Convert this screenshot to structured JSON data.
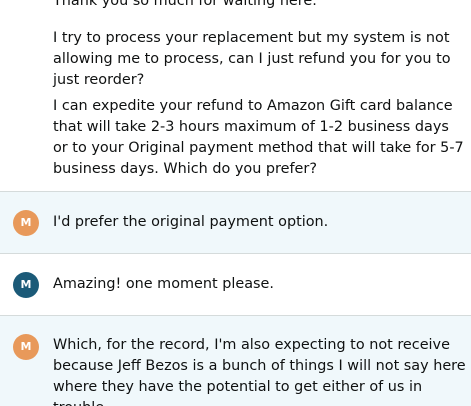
{
  "conversation": {
    "agent_block": {
      "paragraphs": [
        "Thank you so much for waiting here.",
        "I try to process your replacement but my system is not allowing me to process, can I just refund you for you to just reorder?",
        "I can expedite your refund to Amazon Gift card balance that will take 2-3 hours maximum of 1-2 business days or to your Original payment method that will take for 5-7 business days. Which do you prefer?"
      ]
    },
    "messages": [
      {
        "sender": "customer",
        "avatar_letter": "M",
        "avatar_color": "#e8995a",
        "text": "I'd prefer the original payment option."
      },
      {
        "sender": "agent",
        "avatar_letter": "M",
        "avatar_color": "#1b5a78",
        "text": "Amazing! one moment please."
      },
      {
        "sender": "customer",
        "avatar_letter": "M",
        "avatar_color": "#e8995a",
        "text": "Which, for the record, I'm also expecting to not receive because Jeff Bezos is a bunch of things I will not say here where they have the potential to get either of us in trouble."
      }
    ]
  },
  "colors": {
    "customer_row_background": "#f0f8fb",
    "agent_row_background": "#ffffff",
    "divider": "#d5dbdb",
    "text": "#0f1111"
  }
}
